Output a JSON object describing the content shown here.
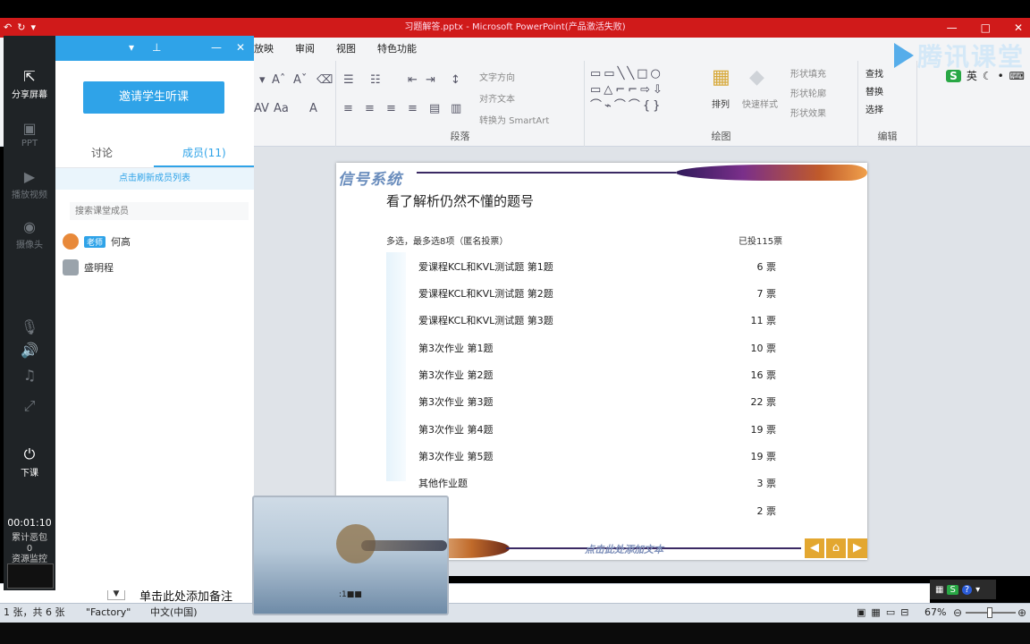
{
  "app": {
    "title": "习题解答.pptx - Microsoft PowerPoint(产品激活失败)",
    "brand": "腾讯课堂"
  },
  "ribbon": {
    "tabs": [
      "放映",
      "审阅",
      "视图",
      "特色功能"
    ],
    "groups": {
      "paragraph": {
        "label": "段落",
        "text_direction": "文字方向",
        "align_text": "对齐文本",
        "smartart": "转换为 SmartArt"
      },
      "drawing": {
        "label": "绘图",
        "arrange": "排列",
        "quick_styles": "快速样式",
        "shape_fill": "形状填充",
        "shape_outline": "形状轮廓",
        "shape_effects": "形状效果"
      },
      "editing": {
        "label": "编辑",
        "find": "查找",
        "replace": "替换",
        "select": "选择"
      }
    },
    "ime": {
      "badge": "S",
      "lang": "英"
    }
  },
  "classroom": {
    "toolbar": {
      "share_screen": "分享屏幕",
      "ppt": "PPT",
      "play_video": "播放视频",
      "camera": "摄像头",
      "end_class": "下课",
      "timer": "00:01:10",
      "accumulated_label": "累计恶包",
      "accumulated_value": "0",
      "resource_monitor": "资源监控"
    },
    "panel": {
      "invite_button": "邀请学生听课",
      "tab_discuss": "讨论",
      "tab_members": "成员(11)",
      "refresh_link": "点击刷新成员列表",
      "search_placeholder": "搜索课堂成员",
      "members": [
        {
          "role": "老师",
          "name": "何高"
        },
        {
          "role": "",
          "name": "盛明程"
        }
      ]
    }
  },
  "slide": {
    "logo": "信号系统",
    "title": "看了解析仍然不懂的题号",
    "subtitle": "多选，最多选8项（匿名投票）",
    "total_votes": "已投115票",
    "options": [
      {
        "label": "爱课程KCL和KVL测试题 第1题",
        "votes": "6 票"
      },
      {
        "label": "爱课程KCL和KVL测试题 第2题",
        "votes": "7 票"
      },
      {
        "label": "爱课程KCL和KVL测试题 第3题",
        "votes": "11 票"
      },
      {
        "label": "第3次作业 第1题",
        "votes": "10 票"
      },
      {
        "label": "第3次作业 第2题",
        "votes": "16 票"
      },
      {
        "label": "第3次作业 第3题",
        "votes": "22 票"
      },
      {
        "label": "第3次作业 第4题",
        "votes": "19 票"
      },
      {
        "label": "第3次作业 第5题",
        "votes": "19 票"
      },
      {
        "label": "其他作业题",
        "votes": "3 票"
      },
      {
        "label": "",
        "votes": "2 票"
      }
    ],
    "footer_text": "点击此处添加文本"
  },
  "notes": {
    "text": "单击此处添加备注"
  },
  "statusbar": {
    "slide_info": "1 张，共 6 张",
    "theme": "\"Factory\"",
    "language": "中文(中国)",
    "zoom": "67%"
  },
  "webcam": {
    "caption": ":1■■"
  }
}
